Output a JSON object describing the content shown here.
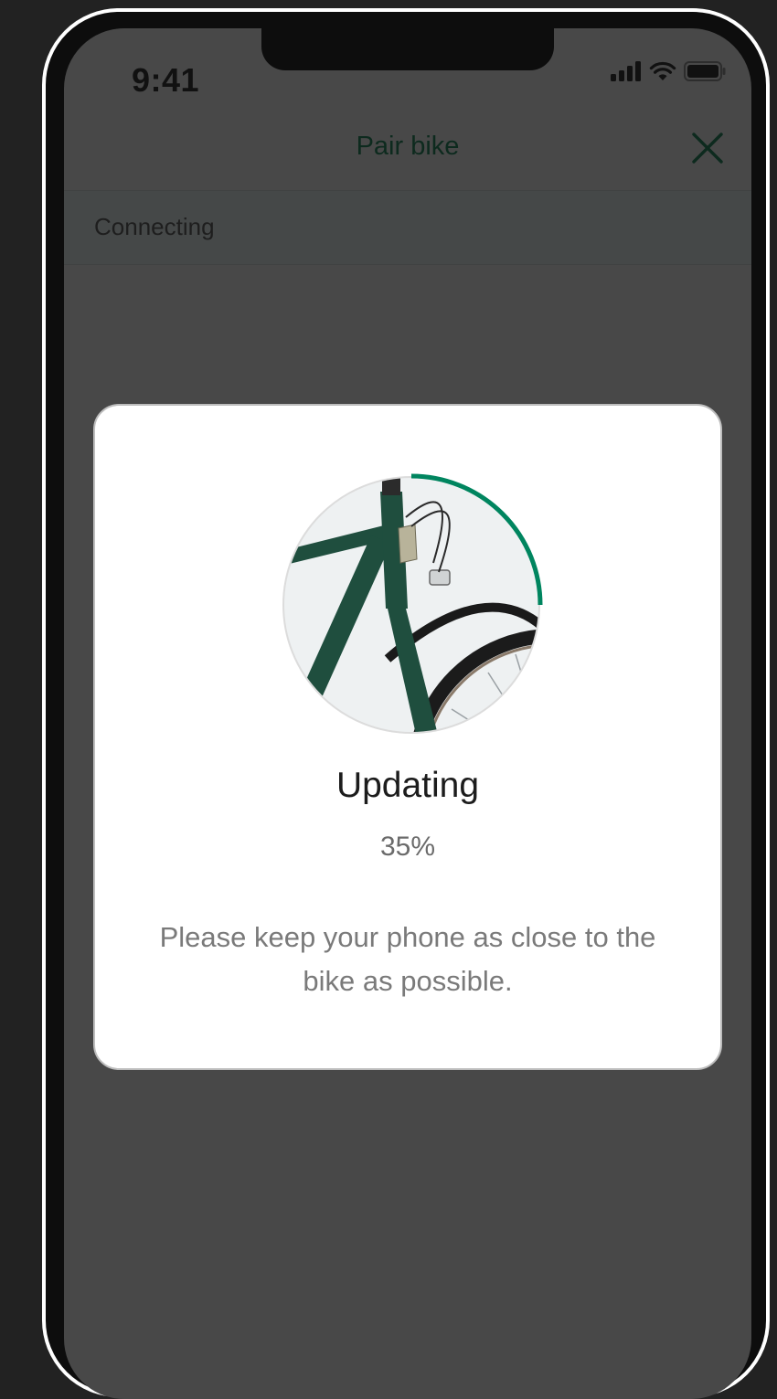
{
  "status_bar": {
    "time": "9:41"
  },
  "header": {
    "title": "Pair bike",
    "close_icon": "close-icon"
  },
  "section": {
    "label": "Connecting"
  },
  "dialog": {
    "title": "Updating",
    "progress_text": "35%",
    "progress_fraction": 0.25,
    "message": "Please keep your phone as close to the bike as possible."
  },
  "colors": {
    "accent": "#00855f",
    "bike_frame": "#1f4e3e",
    "overlay": "#484848"
  }
}
